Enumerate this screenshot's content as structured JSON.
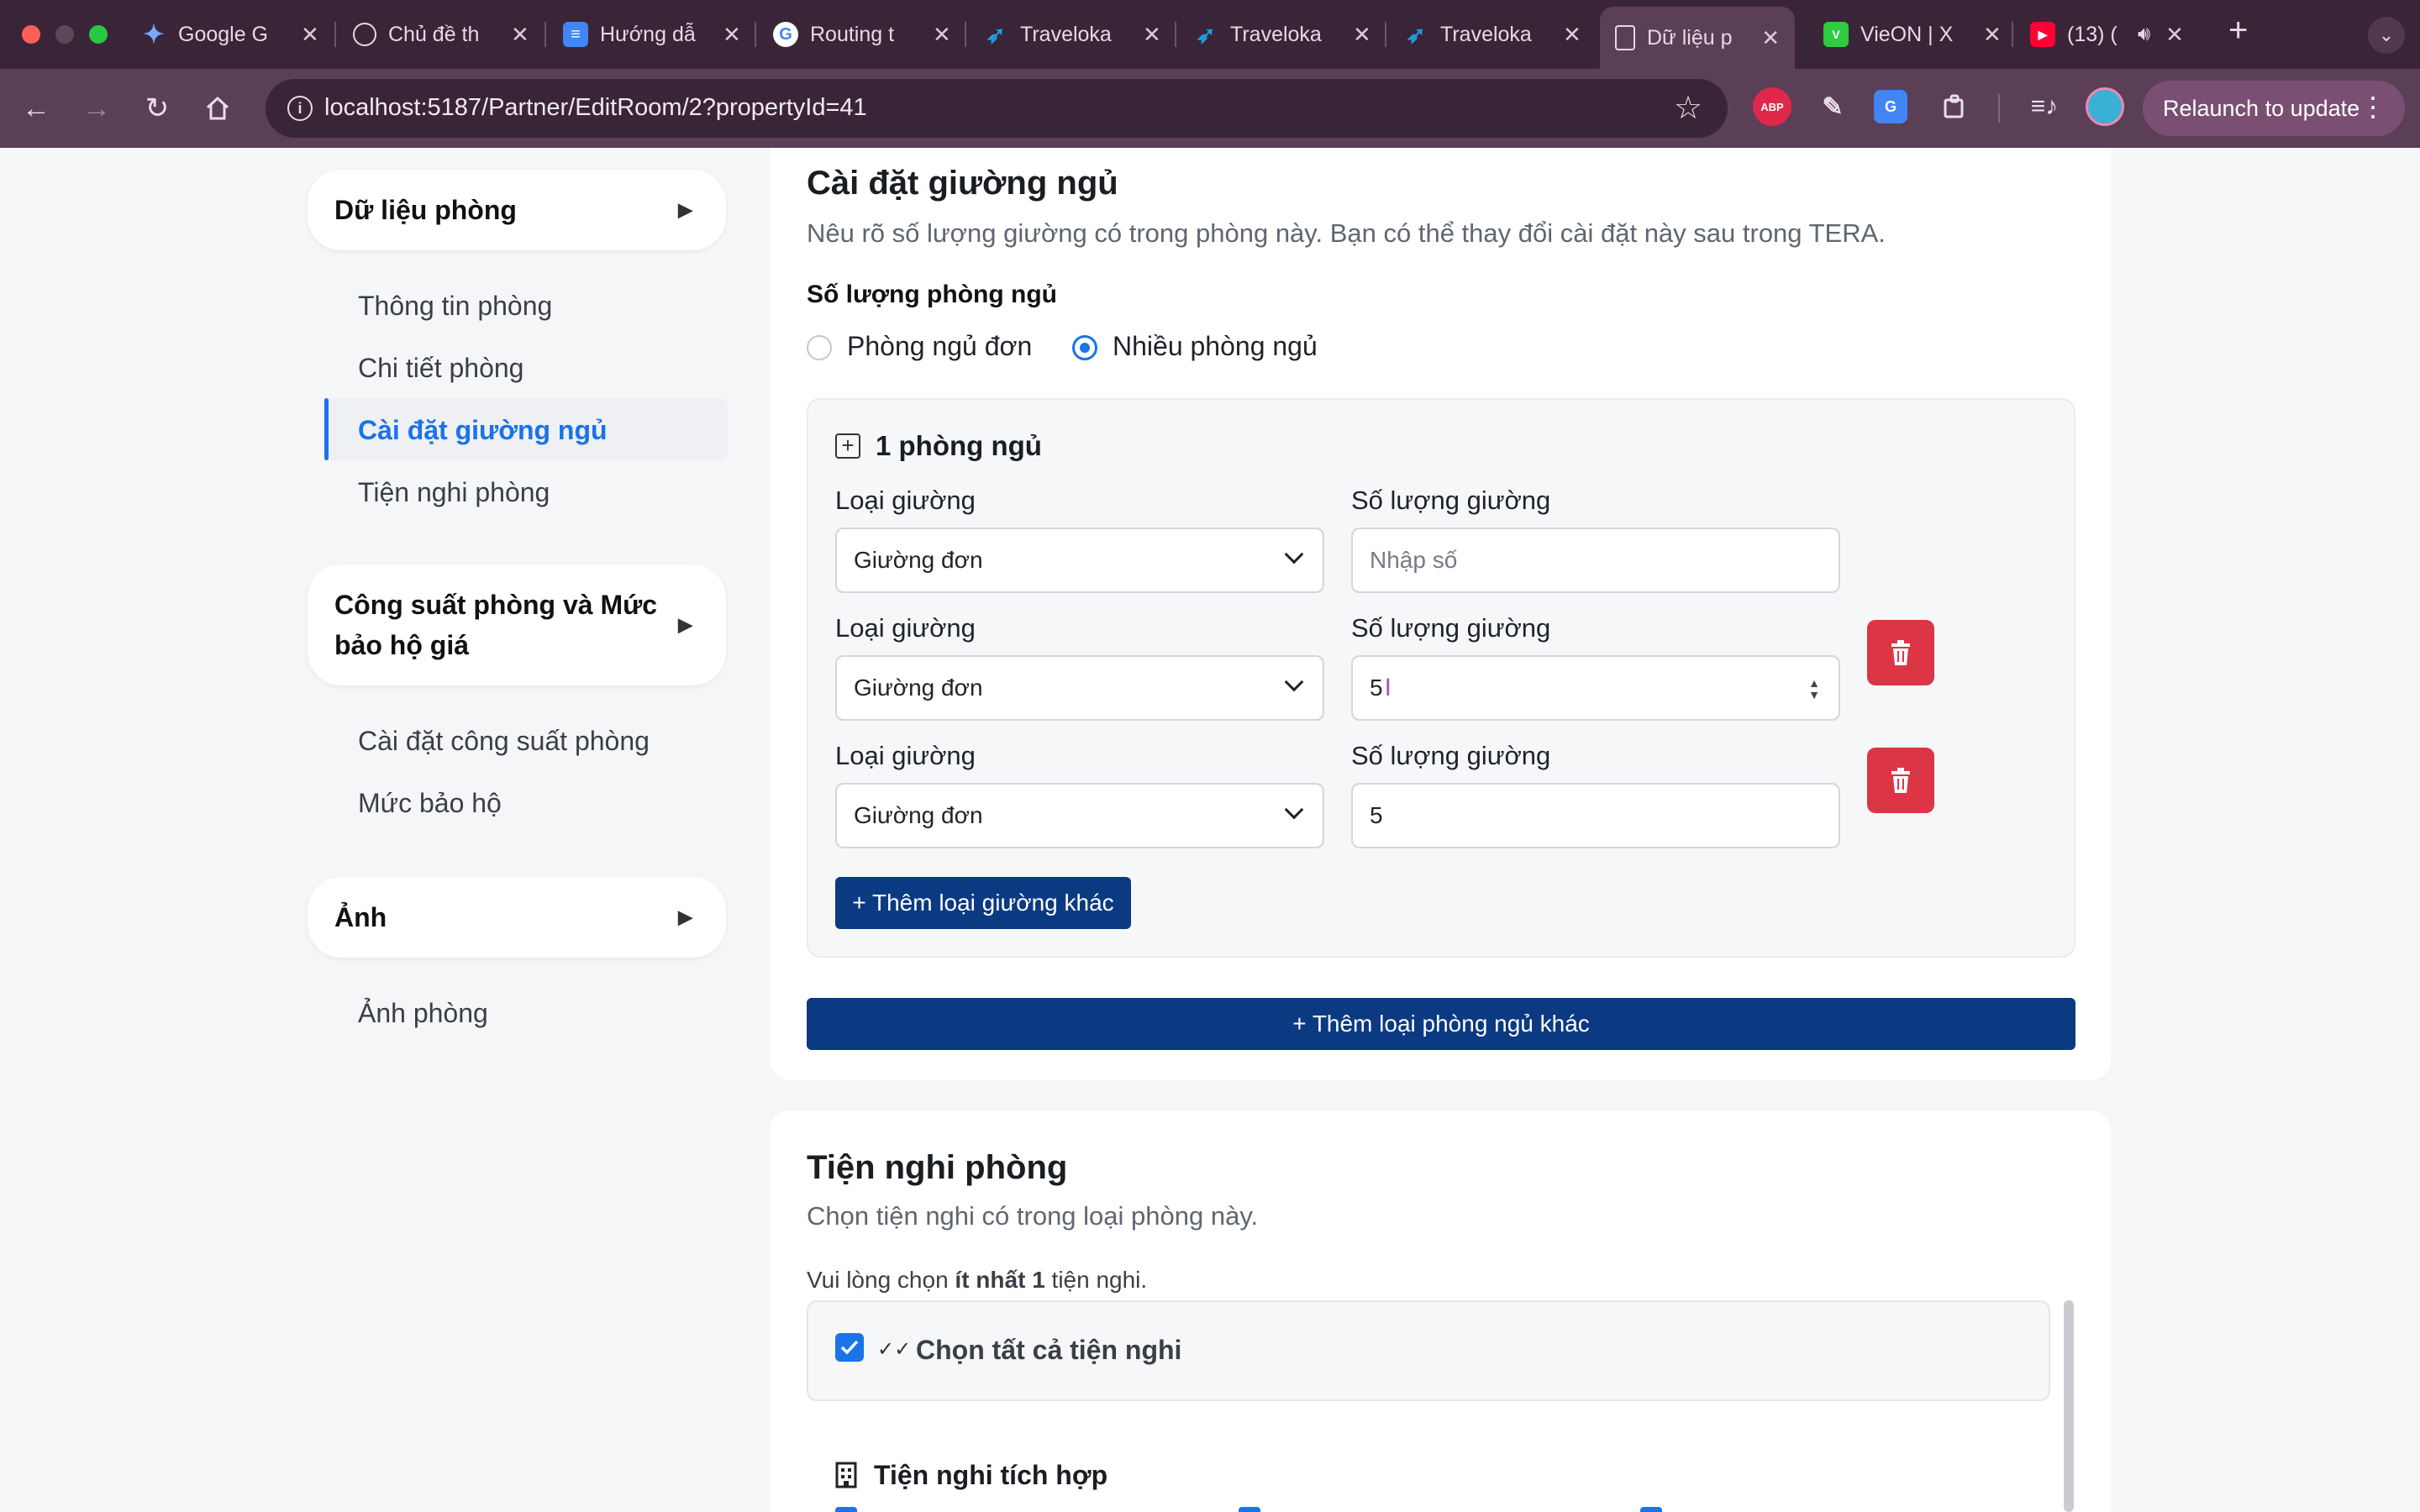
{
  "browser": {
    "tabs": [
      {
        "title": "Google G",
        "favicon": "gemini-icon"
      },
      {
        "title": "Chủ đề th",
        "favicon": "openai-icon"
      },
      {
        "title": "Hướng dẫ",
        "favicon": "docs-icon"
      },
      {
        "title": "Routing t",
        "favicon": "google-icon"
      },
      {
        "title": "Traveloka",
        "favicon": "traveloka-icon"
      },
      {
        "title": "Traveloka",
        "favicon": "traveloka-icon"
      },
      {
        "title": "Traveloka",
        "favicon": "traveloka-icon"
      },
      {
        "title": "Dữ liệu p",
        "favicon": "page-icon",
        "active": true
      },
      {
        "title": "VieON | X",
        "favicon": "vieon-icon"
      },
      {
        "title": "(13) (",
        "favicon": "youtube-icon"
      }
    ],
    "url": "localhost:5187/Partner/EditRoom/2?propertyId=41",
    "relaunch_label": "Relaunch to update",
    "extensions": [
      "adblock-icon",
      "eyedropper-icon",
      "translate-icon",
      "puzzle-icon",
      "media-icon",
      "profile-avatar"
    ]
  },
  "sidebar": {
    "sections": [
      {
        "title": "Dữ liệu phòng",
        "items": [
          "Thông tin phòng",
          "Chi tiết phòng",
          "Cài đặt giường ngủ",
          "Tiện nghi phòng"
        ]
      },
      {
        "title": "Công suất phòng và Mức bảo hộ giá",
        "items": [
          "Cài đặt công suất phòng",
          "Mức bảo hộ"
        ]
      },
      {
        "title": "Ảnh",
        "items": [
          "Ảnh phòng"
        ]
      }
    ],
    "active_item": "Cài đặt giường ngủ"
  },
  "bed_settings": {
    "title": "Cài đặt giường ngủ",
    "description": "Nêu rõ số lượng giường có trong phòng này. Bạn có thể thay đổi cài đặt này sau trong TERA.",
    "bedroom_count_label": "Số lượng phòng ngủ",
    "options": [
      "Phòng ngủ đơn",
      "Nhiều phòng ngủ"
    ],
    "selected_option": "Nhiều phòng ngủ",
    "bedroom": {
      "title": "1 phòng ngủ",
      "rows": [
        {
          "bed_type_label": "Loại giường",
          "bed_type": "Giường đơn",
          "count_label": "Số lượng giường",
          "count_value": "",
          "count_placeholder": "Nhập số"
        },
        {
          "bed_type_label": "Loại giường",
          "bed_type": "Giường đơn",
          "count_label": "Số lượng giường",
          "count_value": "5"
        },
        {
          "bed_type_label": "Loại giường",
          "bed_type": "Giường đơn",
          "count_label": "Số lượng giường",
          "count_value": "5"
        }
      ],
      "add_bed_label": "+ Thêm loại giường khác"
    },
    "add_bedroom_label": "+ Thêm loại phòng ngủ khác"
  },
  "amenities": {
    "title": "Tiện nghi phòng",
    "description": "Chọn tiện nghi có trong loại phòng này.",
    "note_prefix": "Vui lòng chọn ",
    "note_bold": "ít nhất 1",
    "note_suffix": " tiện nghi.",
    "select_all_label": "Chọn tất cả tiện nghi",
    "select_all_checked": true,
    "group_title": "Tiện nghi tích hợp"
  },
  "colors": {
    "primary_button": "#0b3a82",
    "danger": "#dc3545",
    "accent": "#1a73e8",
    "browser_frame": "#5b3f57"
  }
}
